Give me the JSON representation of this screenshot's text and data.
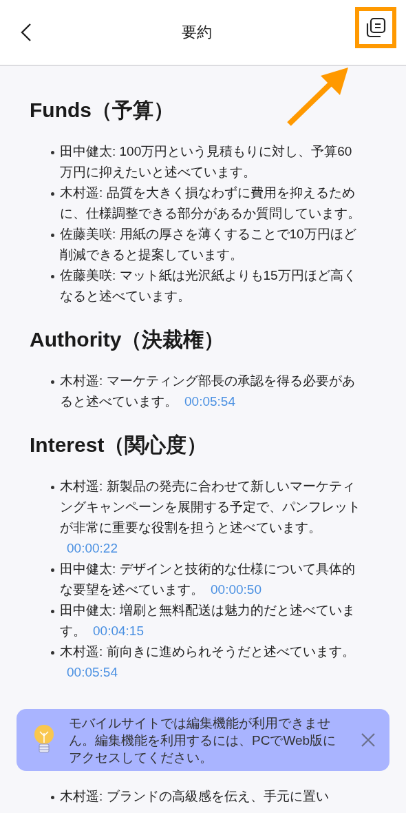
{
  "header": {
    "title": "要約"
  },
  "sections": [
    {
      "heading": "Funds（予算）",
      "items": [
        {
          "text": "田中健太: 100万円という見積もりに対し、予算60万円に抑えたいと述べています。"
        },
        {
          "text": "木村遥: 品質を大きく損なわずに費用を抑えるために、仕様調整できる部分があるか質問しています。"
        },
        {
          "text": "佐藤美咲: 用紙の厚さを薄くすることで10万円ほど削減できると提案しています。"
        },
        {
          "text": "佐藤美咲: マット紙は光沢紙よりも15万円ほど高くなると述べています。"
        }
      ]
    },
    {
      "heading": "Authority（決裁権）",
      "items": [
        {
          "text": "木村遥: マーケティング部長の承認を得る必要があると述べています。",
          "time": "00:05:54"
        }
      ]
    },
    {
      "heading": "Interest（関心度）",
      "items": [
        {
          "text": "木村遥: 新製品の発売に合わせて新しいマーケティングキャンペーンを展開する予定で、パンフレットが非常に重要な役割を担うと述べています。",
          "time": "00:00:22"
        },
        {
          "text": "田中健太: デザインと技術的な仕様について具体的な要望を述べています。",
          "time": "00:00:50"
        },
        {
          "text": "田中健太: 増刷と無料配送は魅力的だと述べています。",
          "time": "00:04:15"
        },
        {
          "text": "木村遥: 前向きに進められそうだと述べています。",
          "time": "00:05:54"
        }
      ]
    }
  ],
  "continued_items": [
    {
      "text": "木村遥: ブランドの高級感を伝え、手元に置い"
    }
  ],
  "banner": {
    "message": "モバイルサイトでは編集機能が利用できません。編集機能を利用するには、PCでWeb版にアクセスしてください。"
  }
}
